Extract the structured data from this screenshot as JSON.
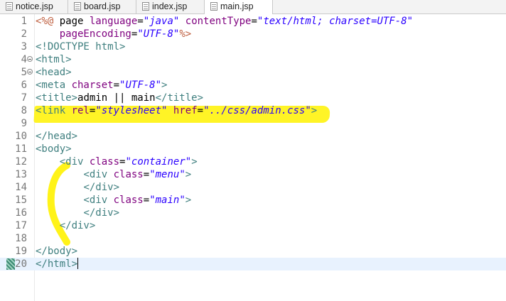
{
  "tabs": [
    {
      "label": "notice.jsp",
      "active": false
    },
    {
      "label": "board.jsp",
      "active": false
    },
    {
      "label": "index.jsp",
      "active": false
    },
    {
      "label": "main.jsp",
      "active": true
    }
  ],
  "colors": {
    "tag": "#3f7f7f",
    "attribute": "#7f007f",
    "string": "#2a00ff",
    "directive": "#bf5f3f",
    "highlight": "#fff200",
    "current_line": "#e8f2fe"
  },
  "lines": [
    {
      "n": "1",
      "segs": [
        [
          "d",
          "<%@ "
        ],
        [
          "p",
          "page "
        ],
        [
          "a",
          "language"
        ],
        [
          "p",
          "="
        ],
        [
          "v",
          "\"java\""
        ],
        [
          "p",
          " "
        ],
        [
          "a",
          "contentType"
        ],
        [
          "p",
          "="
        ],
        [
          "v",
          "\"text/html; charset=UTF-8\""
        ]
      ]
    },
    {
      "n": "2",
      "segs": [
        [
          "p",
          "    "
        ],
        [
          "a",
          "pageEncoding"
        ],
        [
          "p",
          "="
        ],
        [
          "v",
          "\"UTF-8\""
        ],
        [
          "d",
          "%>"
        ]
      ]
    },
    {
      "n": "3",
      "segs": [
        [
          "t",
          "<!DOCTYPE html>"
        ]
      ]
    },
    {
      "n": "4",
      "fold": true,
      "segs": [
        [
          "t",
          "<html>"
        ]
      ]
    },
    {
      "n": "5",
      "fold": true,
      "segs": [
        [
          "t",
          "<head>"
        ]
      ]
    },
    {
      "n": "6",
      "segs": [
        [
          "t",
          "<meta "
        ],
        [
          "a",
          "charset"
        ],
        [
          "p",
          "="
        ],
        [
          "v",
          "\"UTF-8\""
        ],
        [
          "t",
          ">"
        ]
      ]
    },
    {
      "n": "7",
      "segs": [
        [
          "t",
          "<title>"
        ],
        [
          "p",
          "admin || main"
        ],
        [
          "t",
          "</title>"
        ]
      ]
    },
    {
      "n": "8",
      "segs": [
        [
          "t",
          "<link "
        ],
        [
          "a",
          "rel"
        ],
        [
          "p",
          "="
        ],
        [
          "v",
          "\"stylesheet\""
        ],
        [
          "p",
          " "
        ],
        [
          "a",
          "href"
        ],
        [
          "p",
          "="
        ],
        [
          "v",
          "\"../css/admin.css\""
        ],
        [
          "t",
          ">"
        ]
      ]
    },
    {
      "n": "9",
      "segs": []
    },
    {
      "n": "10",
      "segs": [
        [
          "t",
          "</head>"
        ]
      ]
    },
    {
      "n": "11",
      "segs": [
        [
          "t",
          "<body>"
        ]
      ]
    },
    {
      "n": "12",
      "segs": [
        [
          "p",
          "    "
        ],
        [
          "t",
          "<div "
        ],
        [
          "a",
          "class"
        ],
        [
          "p",
          "="
        ],
        [
          "v",
          "\"container\""
        ],
        [
          "t",
          ">"
        ]
      ]
    },
    {
      "n": "13",
      "segs": [
        [
          "p",
          "        "
        ],
        [
          "t",
          "<div "
        ],
        [
          "a",
          "class"
        ],
        [
          "p",
          "="
        ],
        [
          "v",
          "\"menu\""
        ],
        [
          "t",
          ">"
        ]
      ]
    },
    {
      "n": "14",
      "segs": [
        [
          "p",
          "        "
        ],
        [
          "t",
          "</div>"
        ]
      ]
    },
    {
      "n": "15",
      "segs": [
        [
          "p",
          "        "
        ],
        [
          "t",
          "<div "
        ],
        [
          "a",
          "class"
        ],
        [
          "p",
          "="
        ],
        [
          "v",
          "\"main\""
        ],
        [
          "t",
          ">"
        ]
      ]
    },
    {
      "n": "16",
      "segs": [
        [
          "p",
          "        "
        ],
        [
          "t",
          "</div>"
        ]
      ]
    },
    {
      "n": "17",
      "segs": [
        [
          "p",
          "    "
        ],
        [
          "t",
          "</div>"
        ]
      ]
    },
    {
      "n": "18",
      "segs": []
    },
    {
      "n": "19",
      "segs": [
        [
          "t",
          "</body>"
        ]
      ]
    },
    {
      "n": "20",
      "current": true,
      "marker": true,
      "segs": [
        [
          "t",
          "</html>"
        ]
      ]
    }
  ]
}
